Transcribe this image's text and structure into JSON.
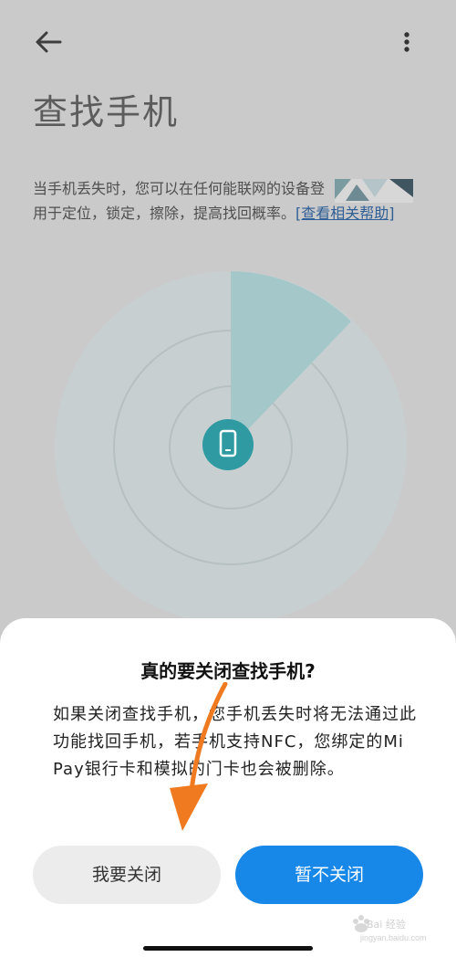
{
  "header": {
    "title": "查找手机",
    "back_icon": "back-arrow-icon",
    "more_icon": "more-vertical-icon"
  },
  "description": {
    "line1": "当手机丢失时，您可以在任何能联网的设备登",
    "line2_prefix": "用于定位，锁定，擦除，提高找回概率。",
    "help_link": "[查看相关帮助]"
  },
  "radar": {
    "device_icon": "phone-icon",
    "accent": "#2f9aa2"
  },
  "dialog": {
    "title": "真的要关闭查找手机?",
    "body": "如果关闭查找手机，您手机丢失时将无法通过此功能找回手机，若手机支持NFC，您绑定的Mi Pay银行卡和模拟的门卡也会被删除。",
    "confirm_label": "我要关闭",
    "cancel_label": "暂不关闭"
  },
  "watermark": {
    "text": "Bai 经验",
    "subtext": "jingyan.baidu.com"
  },
  "colors": {
    "primary": "#1787e8",
    "annotation": "#f07a1f"
  }
}
